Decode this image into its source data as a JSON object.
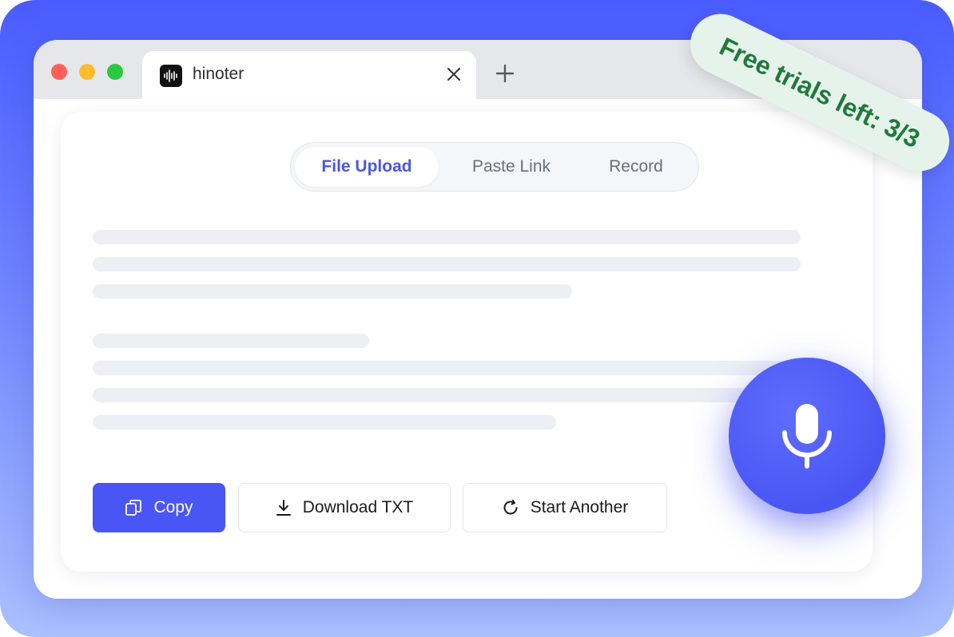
{
  "tab": {
    "title": "hinoter"
  },
  "segments": [
    {
      "label": "File Upload",
      "active": true
    },
    {
      "label": "Paste Link",
      "active": false
    },
    {
      "label": "Record",
      "active": false
    }
  ],
  "buttons": {
    "copy": "Copy",
    "download": "Download TXT",
    "start_another": "Start Another"
  },
  "badge": {
    "text": "Free trials left: 3/3"
  },
  "colors": {
    "accent": "#4a55f5",
    "badge_text": "#1f7a3c",
    "badge_bg": "#e6f3eb"
  },
  "icons": [
    "app-logo-icon",
    "close-icon",
    "plus-icon",
    "copy-icon",
    "download-icon",
    "refresh-icon",
    "microphone-icon"
  ]
}
